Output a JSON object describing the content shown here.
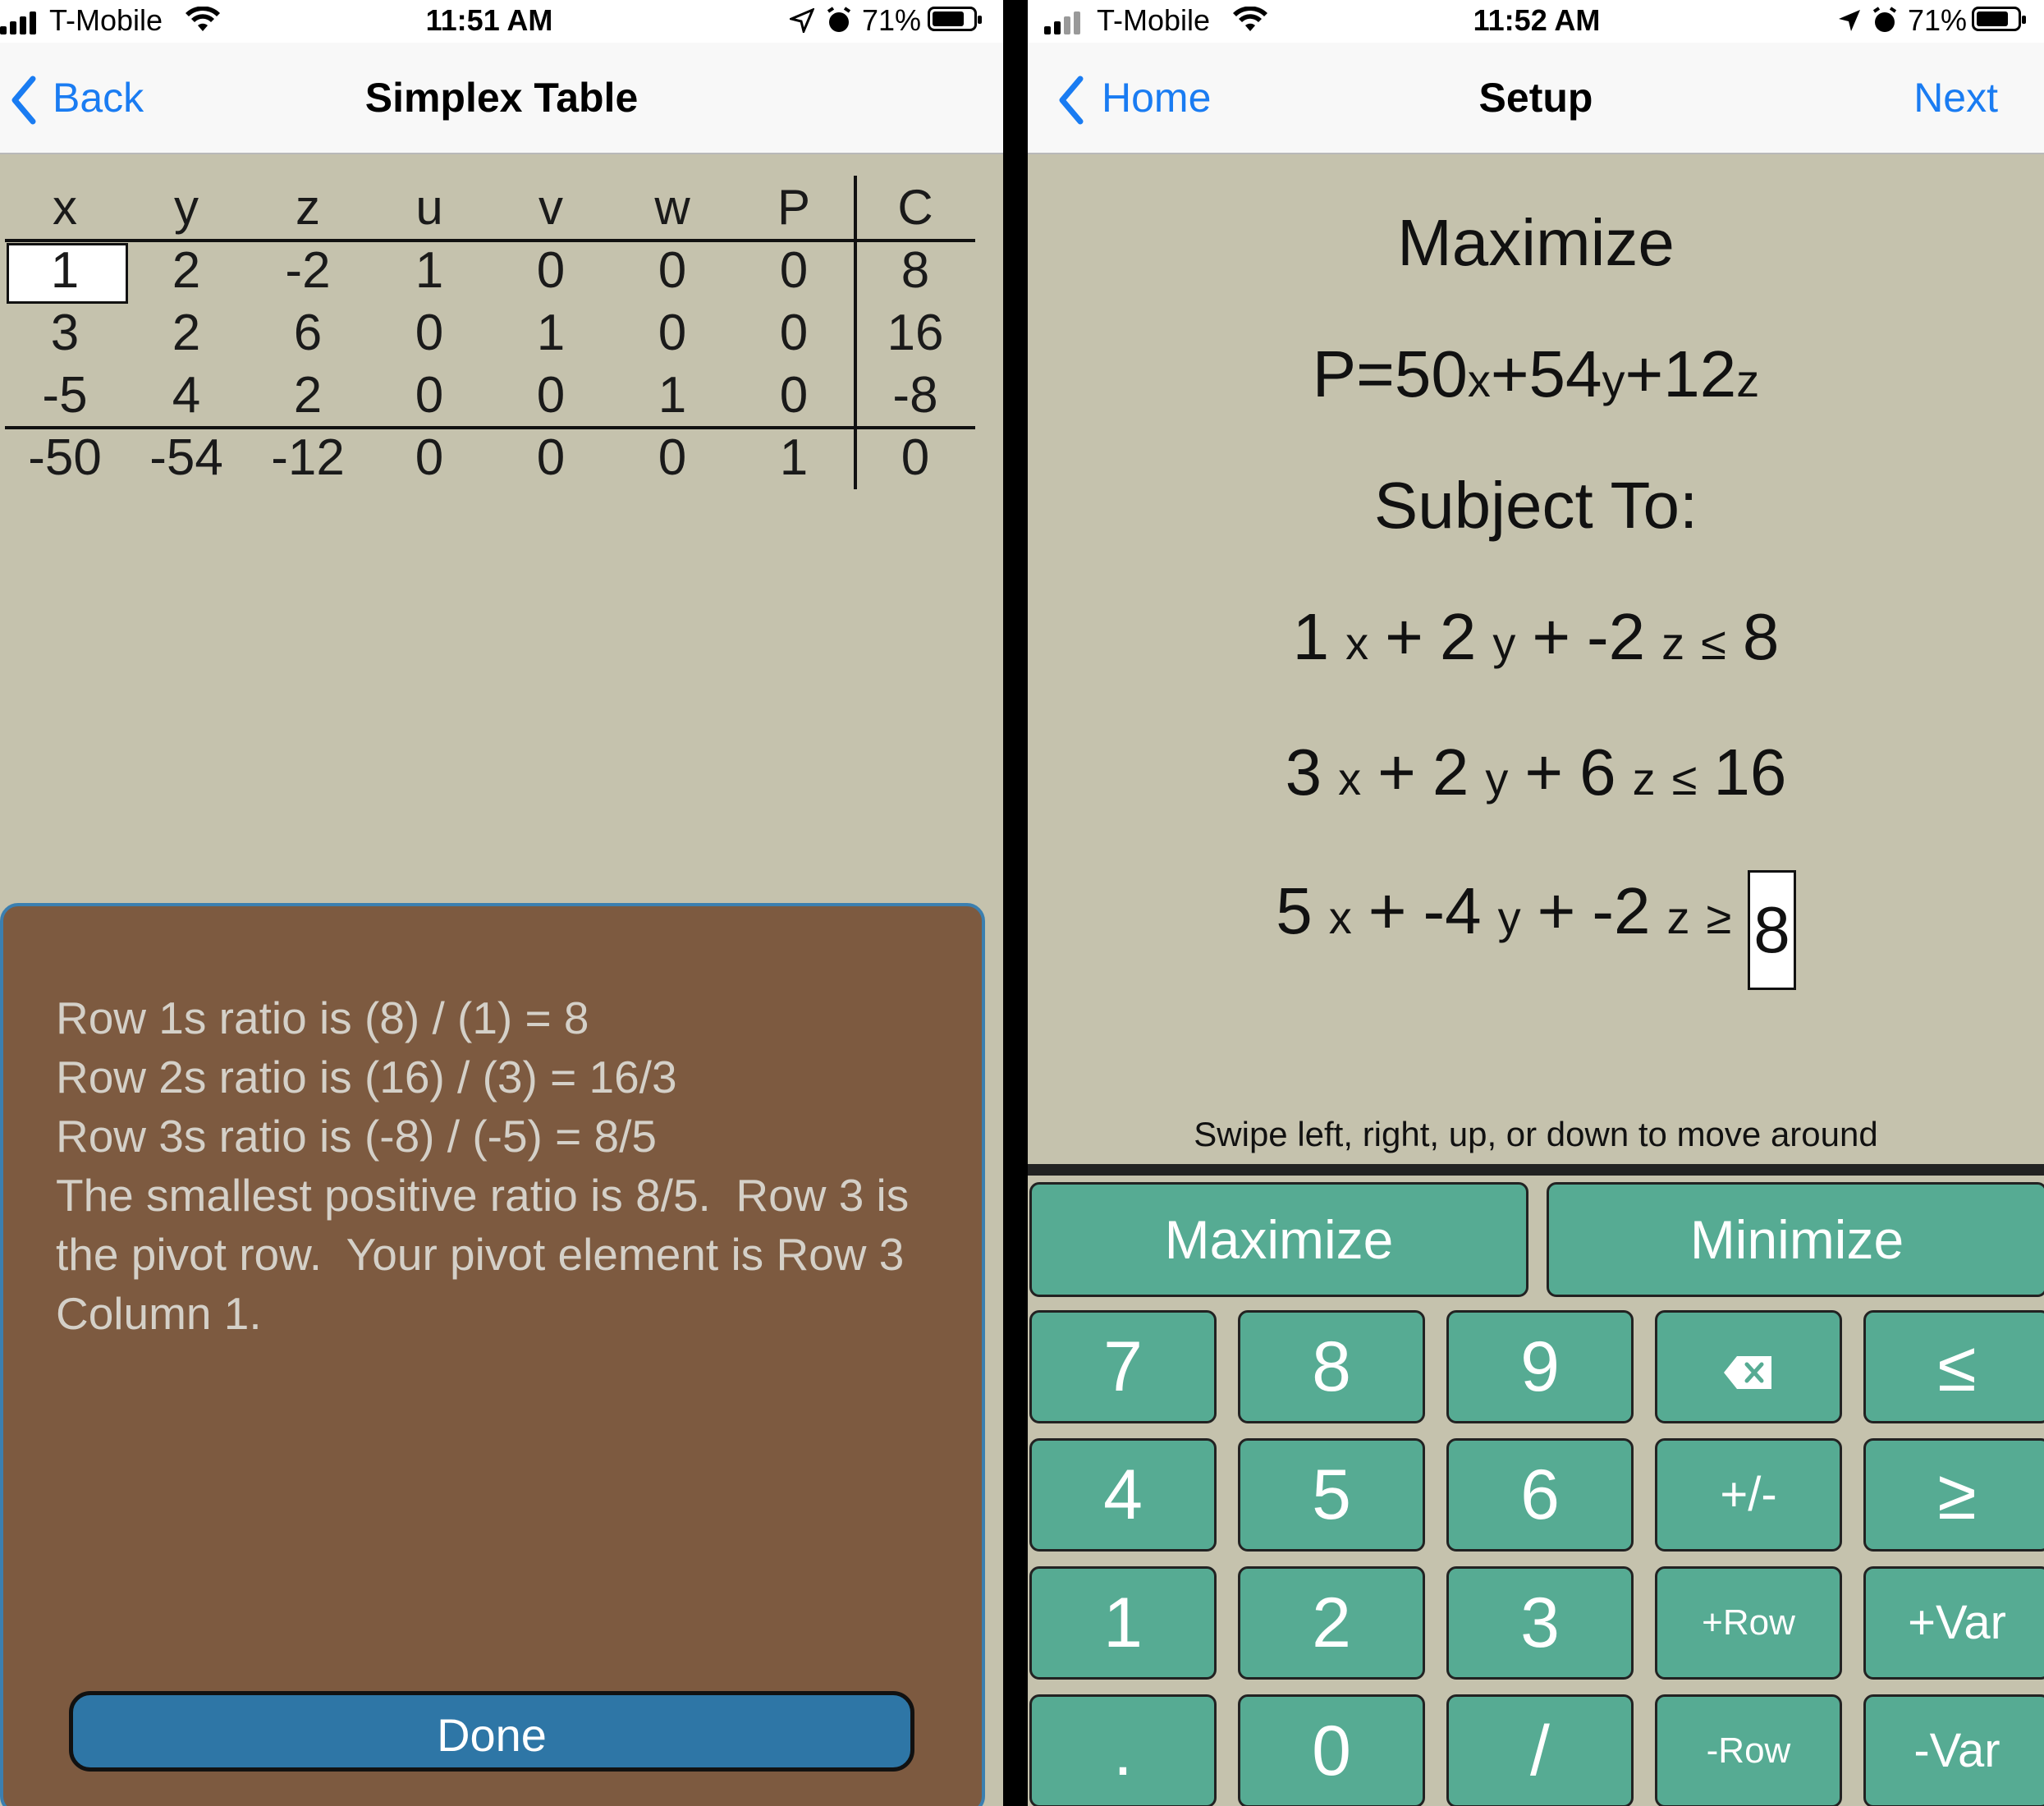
{
  "left": {
    "status": {
      "carrier": "T-Mobile",
      "time": "11:51 AM",
      "battery": "71%"
    },
    "nav": {
      "back_label": "Back",
      "title": "Simplex Table"
    },
    "table": {
      "headers": [
        "x",
        "y",
        "z",
        "u",
        "v",
        "w",
        "P",
        "C"
      ],
      "rows": [
        [
          "1",
          "2",
          "-2",
          "1",
          "0",
          "0",
          "0",
          "8"
        ],
        [
          "3",
          "2",
          "6",
          "0",
          "1",
          "0",
          "0",
          "16"
        ],
        [
          "-5",
          "4",
          "2",
          "0",
          "0",
          "1",
          "0",
          "-8"
        ],
        [
          "-50",
          "-54",
          "-12",
          "0",
          "0",
          "0",
          "1",
          "0"
        ]
      ]
    },
    "popup": {
      "text": "Row 1s ratio is (8) / (1) = 8\nRow 2s ratio is (16) / (3) = 16/3\nRow 3s ratio is (-8) / (-5) = 8/5\nThe smallest positive ratio is 8/5.  Row 3 is the pivot row.  Your pivot element is Row 3 Column 1.",
      "done_label": "Done"
    }
  },
  "right": {
    "status": {
      "carrier": "T-Mobile",
      "time": "11:52 AM",
      "battery": "71%"
    },
    "nav": {
      "back_label": "Home",
      "title": "Setup",
      "next_label": "Next"
    },
    "setup": {
      "heading": "Maximize",
      "objective": {
        "p": "P",
        "eq": "=",
        "c1": "50",
        "v1": "x",
        "plus1": "+",
        "c2": "54",
        "v2": "y",
        "plus2": "+",
        "c3": "12",
        "v3": "z"
      },
      "subject_to": "Subject To:",
      "constraints": [
        {
          "a": "1",
          "x": "x",
          "p1": "+",
          "b": "2",
          "y": "y",
          "p2": "+",
          "c": "-2",
          "z": "z",
          "op": "≤",
          "rhs": "8"
        },
        {
          "a": "3",
          "x": "x",
          "p1": "+",
          "b": "2",
          "y": "y",
          "p2": "+",
          "c": "6",
          "z": "z",
          "op": "≤",
          "rhs": "16"
        },
        {
          "a": "5",
          "x": "x",
          "p1": "+",
          "b": "-4",
          "y": "y",
          "p2": "+",
          "c": "-2",
          "z": "z",
          "op": "≥",
          "rhs": "8"
        }
      ],
      "hint": "Swipe left, right, up, or down to move around"
    },
    "keyboard": {
      "maximize": "Maximize",
      "minimize": "Minimize",
      "keys": [
        [
          "7",
          "8",
          "9",
          "backspace-icon",
          "≤"
        ],
        [
          "4",
          "5",
          "6",
          "+/-",
          "≥"
        ],
        [
          "1",
          "2",
          "3",
          "+Row",
          "+Var"
        ],
        [
          ".",
          "0",
          "/",
          "-Row",
          "-Var"
        ]
      ]
    }
  }
}
